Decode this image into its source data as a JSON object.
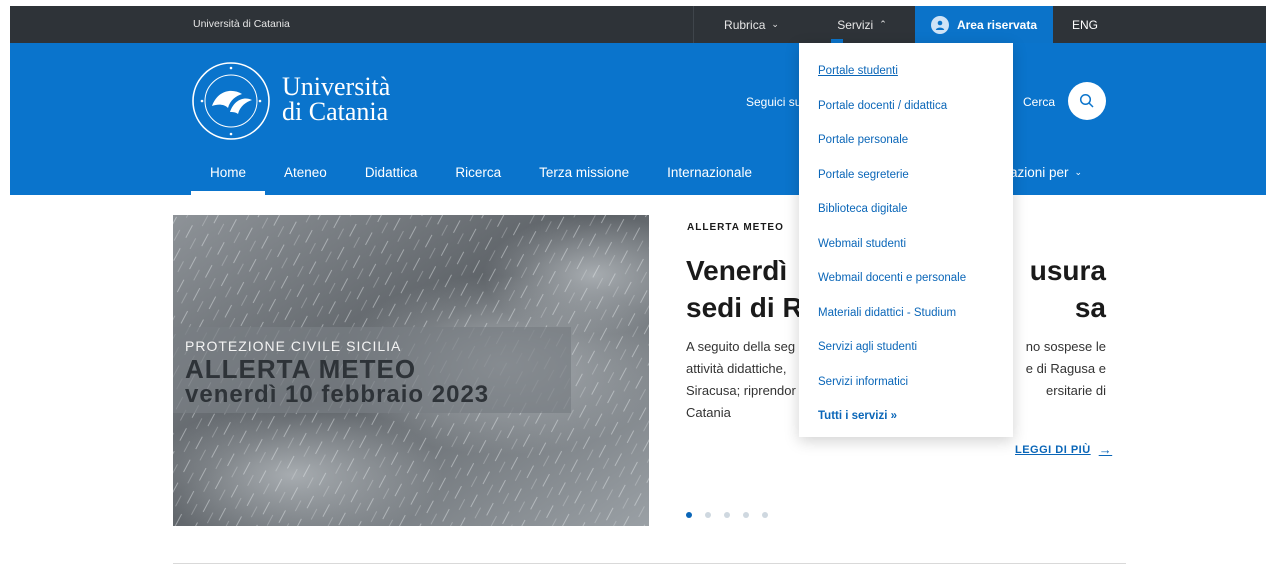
{
  "topbar": {
    "university": "Università di Catania",
    "rubrica": "Rubrica",
    "servizi": "Servizi",
    "area_riservata": "Area riservata",
    "lang": "ENG"
  },
  "header": {
    "brand_line1": "Università",
    "brand_line2": "di Catania",
    "seguici": "Seguici su",
    "cerca": "Cerca"
  },
  "nav": {
    "items": [
      "Home",
      "Ateneo",
      "Didattica",
      "Ricerca",
      "Terza missione",
      "Internazionale"
    ],
    "right": "azioni per"
  },
  "servizi_menu": {
    "items": [
      "Portale studenti",
      "Portale docenti / didattica",
      "Portale personale",
      "Portale segreterie",
      "Biblioteca digitale",
      "Webmail studenti",
      "Webmail docenti e personale",
      "Materiali didattici - Studium",
      "Servizi agli studenti",
      "Servizi informatici"
    ],
    "all": "Tutti i servizi »"
  },
  "hero": {
    "banner_line1": "PROTEZIONE CIVILE SICILIA",
    "banner_line2": "ALLERTA METEO",
    "banner_line3": "venerdì 10 febbraio 2023",
    "kicker": "ALLERTA METEO",
    "headline_line1_left": "Venerdì",
    "headline_line1_right": "usura",
    "headline_line2_left": "sedi di R",
    "headline_line2_right": "sa",
    "body_lines": [
      [
        "A seguito della seg",
        "no sospese le"
      ],
      [
        "attività didattiche,",
        "e di Ragusa e"
      ],
      [
        "Siracusa; riprendor",
        "ersitarie di"
      ],
      [
        "Catania",
        ""
      ]
    ],
    "read_more": "LEGGI DI PIÙ",
    "slides_total": 5,
    "slide_active": 1
  },
  "colors": {
    "topbar": "#2e3338",
    "brand_blue": "#0a74cc",
    "link_blue": "#0a66b8"
  }
}
